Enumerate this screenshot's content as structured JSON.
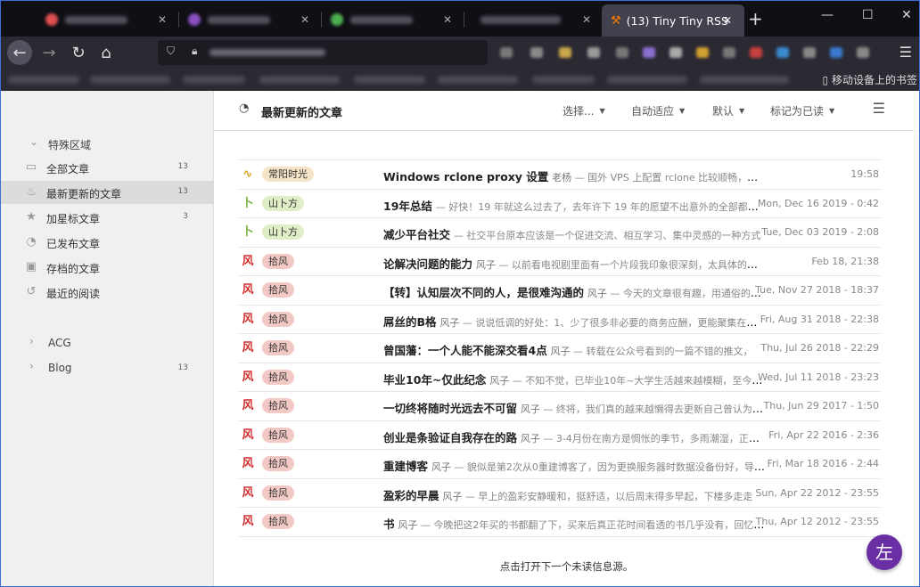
{
  "browser": {
    "active_tab_title": "(13) Tiny Tiny RSS",
    "new_tab_symbol": "+",
    "bookmarks_mobile_label": "移动设备上的书签"
  },
  "sidebar": {
    "special_title": "特殊区域",
    "items": [
      {
        "label": "全部文章",
        "count": "13",
        "icon": "inbox-icon"
      },
      {
        "label": "最新更新的文章",
        "count": "13",
        "icon": "fire-icon"
      },
      {
        "label": "加星标文章",
        "count": "3",
        "icon": "star-icon"
      },
      {
        "label": "已发布文章",
        "count": "",
        "icon": "rss-icon"
      },
      {
        "label": "存档的文章",
        "count": "",
        "icon": "archive-icon"
      },
      {
        "label": "最近的阅读",
        "count": "",
        "icon": "history-icon"
      }
    ],
    "categories": [
      {
        "label": "ACG",
        "count": ""
      },
      {
        "label": "Blog",
        "count": "13"
      }
    ]
  },
  "main": {
    "title": "最新更新的文章",
    "toolbar": {
      "select": "选择...",
      "view_mode": "自动适应",
      "order": "默认",
      "mark_read": "标记为已读"
    },
    "articles": [
      {
        "feed": "常阳时光",
        "feed_color": "#f6e4c6",
        "icon_color": "#d8a21a",
        "icon_char": "∿",
        "title": "Windows rclone proxy 设置",
        "author": "老杨",
        "excerpt": " — 国外 VPS 上配置 rclone 比较顺畅，今天想在本地上传点东西，",
        "date": "19:58"
      },
      {
        "feed": "山卜方",
        "feed_color": "#dfeec6",
        "icon_color": "#7cb342",
        "icon_char": "卜",
        "title": "19年总结",
        "author": "",
        "excerpt": " — 好快！19 年就这么过去了，去年许下 19 年的愿望不出意外的全部都没有实现",
        "date": "Mon, Dec 16 2019 - 0:42"
      },
      {
        "feed": "山卜方",
        "feed_color": "#dfeec6",
        "icon_color": "#7cb342",
        "icon_char": "卜",
        "title": "减少平台社交",
        "author": "",
        "excerpt": " — 社交平台原本应该是一个促进交流、相互学习、集中灵感的一种方式",
        "date": "Tue, Dec 03 2019 - 2:08"
      },
      {
        "feed": "拾风",
        "feed_color": "#f2c9c4",
        "icon_color": "#d32f2f",
        "icon_char": "风",
        "title": "论解决问题的能力",
        "author": "风子",
        "excerpt": " — 以前看电视剧里面有一个片段我印象很深刻，太具体的剧情忘记了",
        "date": "Feb 18, 21:38"
      },
      {
        "feed": "拾风",
        "feed_color": "#f2c9c4",
        "icon_color": "#d32f2f",
        "icon_char": "风",
        "title": "【转】认知层次不同的人，是很难沟通的",
        "author": "风子",
        "excerpt": " — 今天的文章很有趣，用通俗的话讲",
        "date": "Tue, Nov 27 2018 - 18:37"
      },
      {
        "feed": "拾风",
        "feed_color": "#f2c9c4",
        "icon_color": "#d32f2f",
        "icon_char": "风",
        "title": "屌丝的B格",
        "author": "风子",
        "excerpt": " — 说说低调的好处：1、少了很多非必要的商务应酬，更能聚集在自己身上",
        "date": "Fri, Aug 31 2018 - 22:38"
      },
      {
        "feed": "拾风",
        "feed_color": "#f2c9c4",
        "icon_color": "#d32f2f",
        "icon_char": "风",
        "title": "曾国藩：一个人能不能深交看4点",
        "author": "风子",
        "excerpt": " — 转载在公众号看到的一篇不错的推文，",
        "date": "Thu, Jul 26 2018 - 22:29"
      },
      {
        "feed": "拾风",
        "feed_color": "#f2c9c4",
        "icon_color": "#d32f2f",
        "icon_char": "风",
        "title": "毕业10年~仅此纪念",
        "author": "风子",
        "excerpt": " — 不知不觉，已毕业10年~大学生活越来越模糊，至今让人怀念",
        "date": "Wed, Jul 11 2018 - 23:23"
      },
      {
        "feed": "拾风",
        "feed_color": "#f2c9c4",
        "icon_color": "#d32f2f",
        "icon_char": "风",
        "title": "一切终将随时光远去不可留",
        "author": "风子",
        "excerpt": " — 终将，我们真的越来越懒得去更新自己曾认为重要的东西",
        "date": "Thu, Jun 29 2017 - 1:50"
      },
      {
        "feed": "拾风",
        "feed_color": "#f2c9c4",
        "icon_color": "#d32f2f",
        "icon_char": "风",
        "title": "创业是条验证自我存在的路",
        "author": "风子",
        "excerpt": " — 3-4月份在南方是惆怅的季节，多雨潮湿，正如心情一般",
        "date": "Fri, Apr 22 2016 - 2:36"
      },
      {
        "feed": "拾风",
        "feed_color": "#f2c9c4",
        "icon_color": "#d32f2f",
        "icon_char": "风",
        "title": "重建博客",
        "author": "风子",
        "excerpt": " — 貌似是第2次从0重建博客了，因为更换服务器时数据没备份好，导致全部丢失",
        "date": "Fri, Mar 18 2016 - 2:44"
      },
      {
        "feed": "拾风",
        "feed_color": "#f2c9c4",
        "icon_color": "#d32f2f",
        "icon_char": "风",
        "title": "盈彩的早晨",
        "author": "风子",
        "excerpt": " — 早上的盈彩安静暖和，挺舒适，以后周末得多早起，下楼多走走",
        "date": "Sun, Apr 22 2012 - 23:55"
      },
      {
        "feed": "拾风",
        "feed_color": "#f2c9c4",
        "icon_color": "#d32f2f",
        "icon_char": "风",
        "title": "书",
        "author": "风子",
        "excerpt": " — 今晚把这2年买的书都翻了下，买来后真正花时间看透的书几乎没有，回忆一下",
        "date": "Thu, Apr 12 2012 - 23:55"
      }
    ],
    "footer_text": "点击打开下一个未读信息源。",
    "fab_symbol": "左"
  }
}
